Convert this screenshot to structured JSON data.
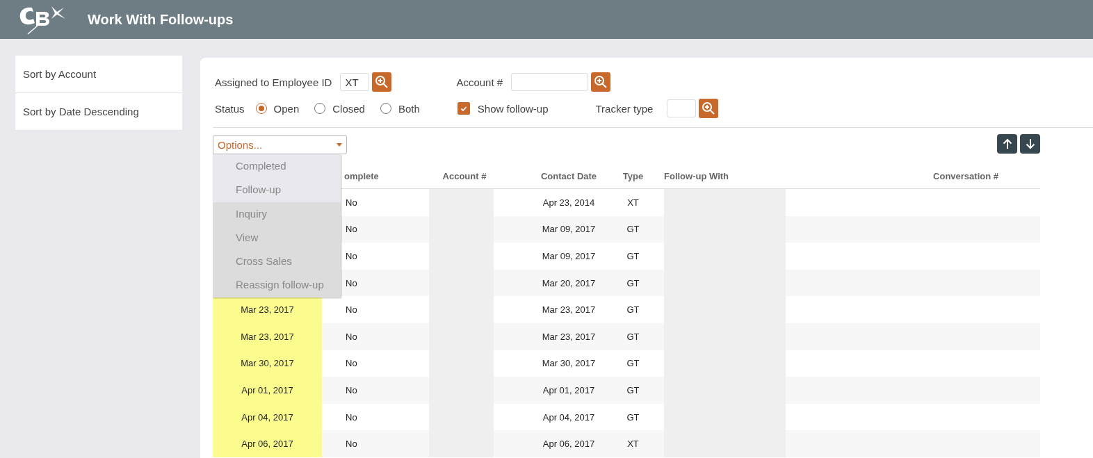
{
  "header": {
    "title": "Work With Follow-ups"
  },
  "sidebar": {
    "items": [
      {
        "label": "Sort by Account"
      },
      {
        "label": "Sort by Date Descending"
      }
    ]
  },
  "filters": {
    "employee_label": "Assigned to Employee ID",
    "employee_value": "XT",
    "account_label": "Account #",
    "status_label": "Status",
    "status_options": [
      {
        "label": "Open",
        "selected": true
      },
      {
        "label": "Closed",
        "selected": false
      },
      {
        "label": "Both",
        "selected": false
      }
    ],
    "show_followup": {
      "label": "Show follow-up",
      "checked": true
    },
    "tracker_label": "Tracker type"
  },
  "options_dropdown": {
    "label": "Options...",
    "expanded": true,
    "items": [
      {
        "label": "Completed",
        "shaded": false
      },
      {
        "label": "Follow-up",
        "shaded": false
      },
      {
        "label": "Inquiry",
        "shaded": true
      },
      {
        "label": "View",
        "shaded": true
      },
      {
        "label": "Cross Sales",
        "shaded": true
      },
      {
        "label": "Reassign follow-up",
        "shaded": true
      }
    ]
  },
  "table": {
    "columns": [
      "omplete",
      "Account #",
      "Contact Date",
      "Type",
      "Follow-up With",
      "Conversation #"
    ],
    "rows": [
      {
        "complete": "No",
        "contact_date": "Apr 23, 2014",
        "type": "XT"
      },
      {
        "complete": "No",
        "contact_date": "Mar 09, 2017",
        "type": "GT"
      },
      {
        "complete": "No",
        "contact_date": "Mar 09, 2017",
        "type": "GT"
      },
      {
        "complete": "No",
        "contact_date": "Mar 20, 2017",
        "type": "GT"
      },
      {
        "date": "Mar 23, 2017",
        "complete": "No",
        "contact_date": "Mar 23, 2017",
        "type": "GT"
      },
      {
        "date": "Mar 23, 2017",
        "complete": "No",
        "contact_date": "Mar 23, 2017",
        "type": "GT"
      },
      {
        "date": "Mar 30, 2017",
        "complete": "No",
        "contact_date": "Mar 30, 2017",
        "type": "GT"
      },
      {
        "date": "Apr 01, 2017",
        "complete": "No",
        "contact_date": "Apr 01, 2017",
        "type": "GT"
      },
      {
        "date": "Apr 04, 2017",
        "complete": "No",
        "contact_date": "Apr 04, 2017",
        "type": "GT"
      },
      {
        "date": "Apr 06, 2017",
        "complete": "No",
        "contact_date": "Apr 06, 2017",
        "type": "XT"
      }
    ]
  }
}
